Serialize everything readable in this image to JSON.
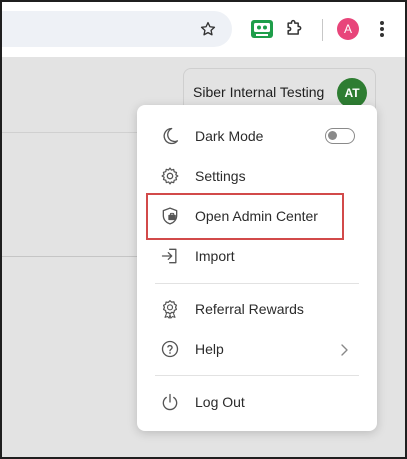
{
  "toolbar": {
    "star_icon": "star-icon",
    "profile_initial": "A",
    "profile_color": "#e8457a"
  },
  "account": {
    "name": "Siber Internal Testing",
    "initials": "AT",
    "initials_color": "#2e7d32"
  },
  "menu": {
    "items": [
      {
        "label": "Dark Mode",
        "icon": "moon-icon",
        "toggle": false
      },
      {
        "label": "Settings",
        "icon": "gear-icon"
      },
      {
        "label": "Open Admin Center",
        "icon": "shield-briefcase-icon",
        "highlighted": true
      },
      {
        "label": "Import",
        "icon": "import-icon"
      },
      {
        "label": "Referral Rewards",
        "icon": "award-badge-icon"
      },
      {
        "label": "Help",
        "icon": "help-circle-icon",
        "submenu": true
      },
      {
        "label": "Log Out",
        "icon": "power-icon"
      }
    ]
  },
  "colors": {
    "highlight_border": "#d24a4a",
    "page_background": "#e3e3e3"
  }
}
